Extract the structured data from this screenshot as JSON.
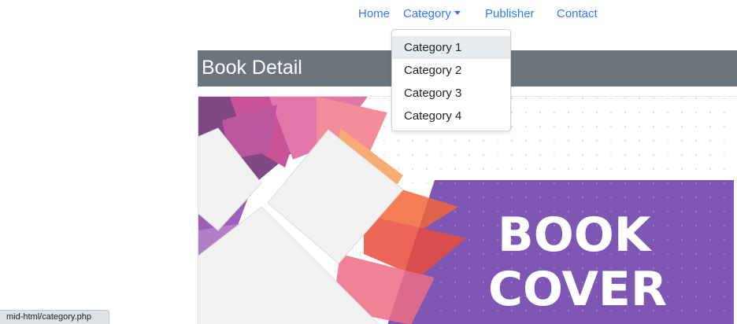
{
  "nav": {
    "items": [
      {
        "label": "Home"
      },
      {
        "label": "Category"
      },
      {
        "label": "Publisher"
      },
      {
        "label": "Contact"
      }
    ]
  },
  "dropdown": {
    "items": [
      {
        "label": "Category 1",
        "active": true
      },
      {
        "label": "Category 2"
      },
      {
        "label": "Category 3"
      },
      {
        "label": "Category 4"
      }
    ]
  },
  "page": {
    "title": "Book Detail"
  },
  "cover_image": {
    "line1": "BOOK",
    "line2": "COVER"
  },
  "status_bar": {
    "url": "mid-html/category.php"
  },
  "colors": {
    "link": "#2f7bf6",
    "header_bg": "#6c757d",
    "cover_band": "#7e57b5",
    "dropdown_active": "#e9ecef"
  }
}
